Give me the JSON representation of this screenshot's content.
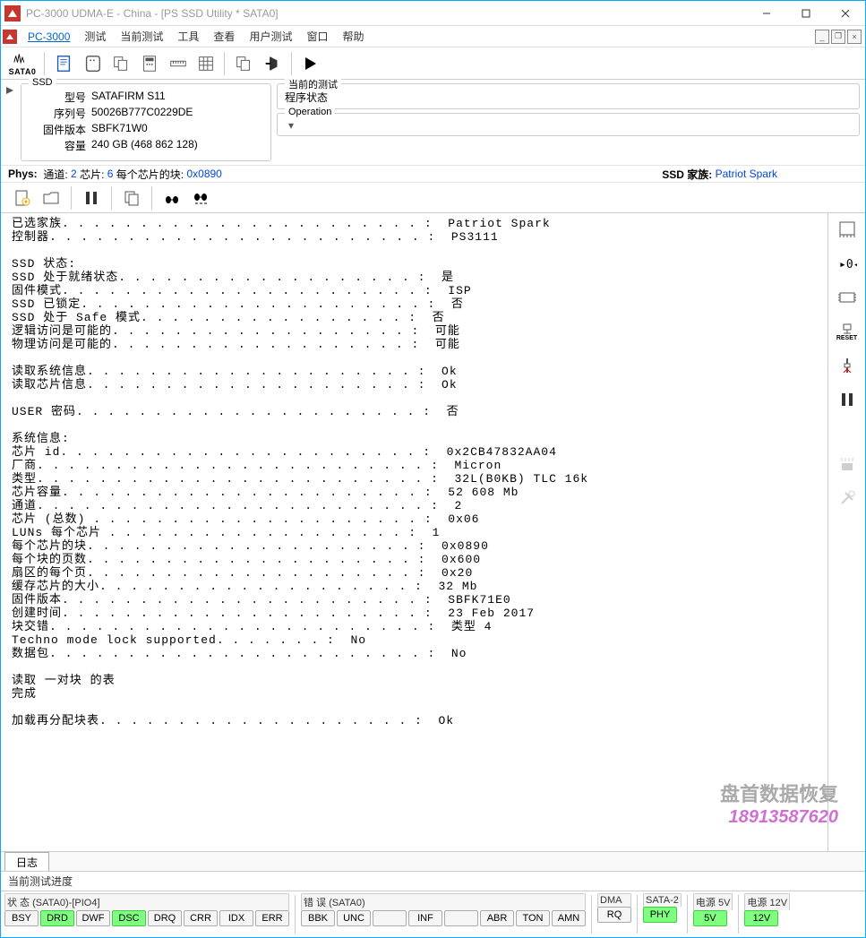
{
  "title": "PC-3000 UDMA-E - China - [PS SSD Utility * SATA0]",
  "menu": {
    "main": "PC-3000",
    "items": [
      "测试",
      "当前测试",
      "工具",
      "查看",
      "用户测试",
      "窗口",
      "帮助"
    ]
  },
  "ssd": {
    "legend": "SSD",
    "model_lbl": "型号",
    "model": "SATAFIRM   S11",
    "serial_lbl": "序列号",
    "serial": "50026B777C0229DE",
    "fw_lbl": "固件版本",
    "fw": "SBFK71W0",
    "cap_lbl": "容量",
    "cap": "240 GB (468 862 128)"
  },
  "currentTest": {
    "legend": "当前的测试",
    "value": "程序状态"
  },
  "operation": {
    "legend": "Operation",
    "value": ""
  },
  "phys": {
    "label": "Phys:",
    "ch_lbl": "通道:",
    "ch": "2",
    "chip_lbl": "芯片:",
    "chip": "6",
    "blk_lbl": "每个芯片的块:",
    "blk": "0x0890",
    "ssd_lbl": "SSD 家族:",
    "ssd": "Patriot Spark"
  },
  "log_lines": [
    "已选家族. . . . . . . . . . . . . . . . . . . . . . . :  Patriot Spark",
    "控制器. . . . . . . . . . . . . . . . . . . . . . . . :  PS3111",
    "",
    "SSD 状态:",
    "SSD 处于就绪状态. . . . . . . . . . . . . . . . . . . :  是",
    "固件模式. . . . . . . . . . . . . . . . . . . . . . . :  ISP",
    "SSD 已锁定. . . . . . . . . . . . . . . . . . . . . . :  否",
    "SSD 处于 Safe 模式. . . . . . . . . . . . . . . . . :  否",
    "逻辑访问是可能的. . . . . . . . . . . . . . . . . . . :  可能",
    "物理访问是可能的. . . . . . . . . . . . . . . . . . . :  可能",
    "",
    "读取系统信息. . . . . . . . . . . . . . . . . . . . . :  Ok",
    "读取芯片信息. . . . . . . . . . . . . . . . . . . . . :  Ok",
    "",
    "USER 密码. . . . . . . . . . . . . . . . . . . . . . :  否",
    "",
    "系统信息:",
    "芯片 id. . . . . . . . . . . . . . . . . . . . . . . :  0x2CB47832AA04",
    "厂商. . . . . . . . . . . . . . . . . . . . . . . . . :  Micron",
    "类型. . . . . . . . . . . . . . . . . . . . . . . . . :  32L(B0KB) TLC 16k",
    "芯片容量. . . . . . . . . . . . . . . . . . . . . . . :  52 608 Mb",
    "通道. . . . . . . . . . . . . . . . . . . . . . . . . :  2",
    "芯片 (总数) . . . . . . . . . . . . . . . . . . . . . :  0x06",
    "LUNs 每个芯片 . . . . . . . . . . . . . . . . . . . :  1",
    "每个芯片的块. . . . . . . . . . . . . . . . . . . . . :  0x0890",
    "每个块的页数. . . . . . . . . . . . . . . . . . . . . :  0x600",
    "扇区的每个页. . . . . . . . . . . . . . . . . . . . . :  0x20",
    "缓存芯片的大小. . . . . . . . . . . . . . . . . . . . :  32 Mb",
    "固件版本. . . . . . . . . . . . . . . . . . . . . . . :  SBFK71E0",
    "创建时间. . . . . . . . . . . . . . . . . . . . . . . :  23 Feb 2017",
    "块交错. . . . . . . . . . . . . . . . . . . . . . . . :  类型 4",
    "Techno mode lock supported. . . . . . . :  No",
    "数据包. . . . . . . . . . . . . . . . . . . . . . . . :  No",
    "",
    "读取 一对块 的表",
    "完成",
    "",
    "加载再分配块表. . . . . . . . . . . . . . . . . . . . :  Ok"
  ],
  "watermark": {
    "line1": "盘首数据恢复",
    "line2": "18913587620"
  },
  "tab": "日志",
  "progress": "当前测试进度",
  "status": {
    "g1_title": "状 态 (SATA0)-[PIO4]",
    "g1": [
      {
        "l": "BSY",
        "on": false
      },
      {
        "l": "DRD",
        "on": true
      },
      {
        "l": "DWF",
        "on": false
      },
      {
        "l": "DSC",
        "on": true
      },
      {
        "l": "DRQ",
        "on": false
      },
      {
        "l": "CRR",
        "on": false
      },
      {
        "l": "IDX",
        "on": false
      },
      {
        "l": "ERR",
        "on": false
      }
    ],
    "g2_title": "错 误 (SATA0)",
    "g2": [
      {
        "l": "BBK",
        "on": false
      },
      {
        "l": "UNC",
        "on": false
      },
      {
        "l": "",
        "on": false
      },
      {
        "l": "INF",
        "on": false
      },
      {
        "l": "",
        "on": false
      },
      {
        "l": "ABR",
        "on": false
      },
      {
        "l": "TON",
        "on": false
      },
      {
        "l": "AMN",
        "on": false
      }
    ],
    "g3_title": "DMA",
    "g3": [
      {
        "l": "RQ",
        "on": false
      }
    ],
    "g4_title": "SATA-2",
    "g4": [
      {
        "l": "PHY",
        "on": true
      }
    ],
    "g5_title": "电源 5V",
    "g5": [
      {
        "l": "5V",
        "on": true
      }
    ],
    "g6_title": "电源 12V",
    "g6": [
      {
        "l": "12V",
        "on": true
      }
    ]
  },
  "side_reset": "RESET",
  "sata0": "SATA0"
}
